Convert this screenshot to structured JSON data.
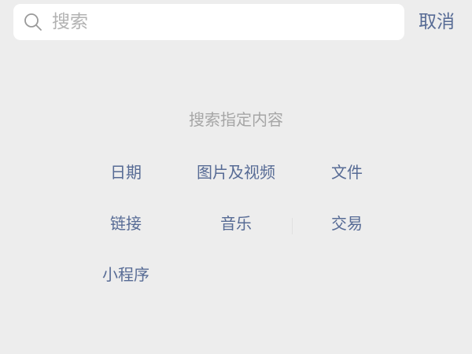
{
  "search": {
    "placeholder": "搜索",
    "value": ""
  },
  "cancel_label": "取消",
  "section_title": "搜索指定内容",
  "filters": [
    {
      "label": "日期"
    },
    {
      "label": "图片及视频"
    },
    {
      "label": "文件"
    },
    {
      "label": "链接"
    },
    {
      "label": "音乐"
    },
    {
      "label": "交易"
    },
    {
      "label": "小程序"
    }
  ],
  "colors": {
    "background": "#ededed",
    "accent": "#576b95",
    "hint": "#a6a6a6",
    "placeholder": "#b2b2b2"
  },
  "icons": {
    "search": "search-icon"
  }
}
